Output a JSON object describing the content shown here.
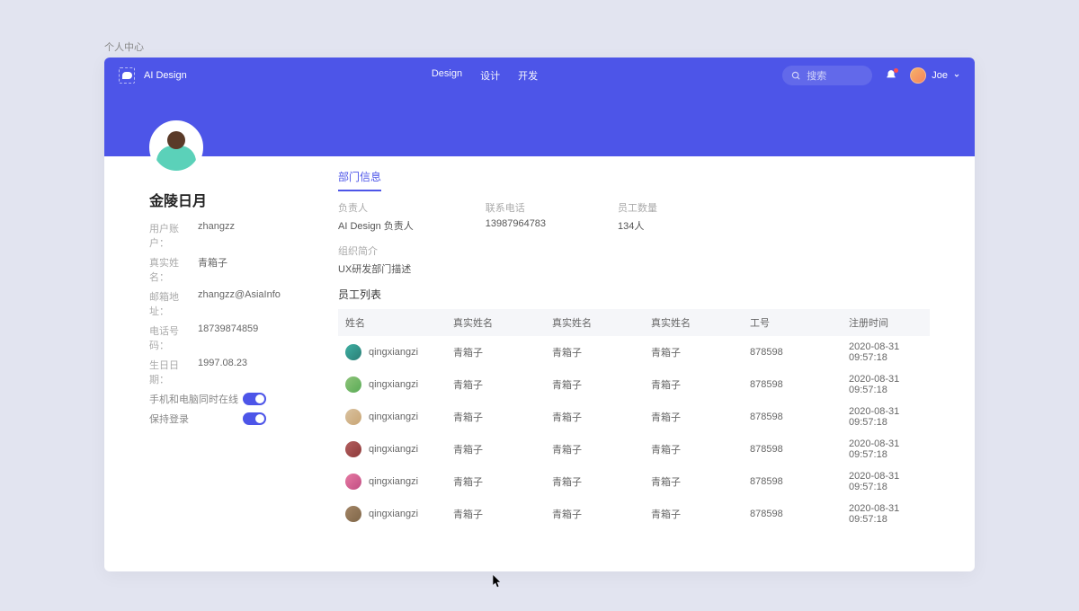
{
  "breadcrumb": "个人中心",
  "header": {
    "brand": "AI Design",
    "nav": {
      "design": "Design",
      "sheji": "设计",
      "kaifa": "开发"
    },
    "search_placeholder": "搜索",
    "user_name": "Joe"
  },
  "profile": {
    "name": "金陵日月",
    "meta": {
      "account_label": "用户账户：",
      "account_value": "zhangzz",
      "realname_label": "真实姓名：",
      "realname_value": "青箱子",
      "email_label": "邮箱地址：",
      "email_value": "zhangzz@AsiaInfo",
      "phone_label": "电话号码：",
      "phone_value": "18739874859",
      "birth_label": "生日日期：",
      "birth_value": "1997.08.23"
    },
    "toggle1_label": "手机和电脑同时在线",
    "toggle2_label": "保持登录"
  },
  "tabs": {
    "dept": "部门信息"
  },
  "dept_info": {
    "manager_label": "负责人",
    "manager_value": "AI Design 负责人",
    "phone_label": "联系电话",
    "phone_value": "13987964783",
    "count_label": "员工数量",
    "count_value": "134人",
    "desc_label": "组织简介",
    "desc_value": "UX研发部门描述"
  },
  "list_title": "员工列表",
  "columns": {
    "c0": "姓名",
    "c1": "真实姓名",
    "c2": "真实姓名",
    "c3": "真实姓名",
    "c4": "工号",
    "c5": "注册时间"
  },
  "rows": [
    {
      "name": "qingxiangzi",
      "real1": "青箱子",
      "real2": "青箱子",
      "real3": "青箱子",
      "code": "878598",
      "time": "2020-08-31 09:57:18"
    },
    {
      "name": "qingxiangzi",
      "real1": "青箱子",
      "real2": "青箱子",
      "real3": "青箱子",
      "code": "878598",
      "time": "2020-08-31 09:57:18"
    },
    {
      "name": "qingxiangzi",
      "real1": "青箱子",
      "real2": "青箱子",
      "real3": "青箱子",
      "code": "878598",
      "time": "2020-08-31 09:57:18"
    },
    {
      "name": "qingxiangzi",
      "real1": "青箱子",
      "real2": "青箱子",
      "real3": "青箱子",
      "code": "878598",
      "time": "2020-08-31 09:57:18"
    },
    {
      "name": "qingxiangzi",
      "real1": "青箱子",
      "real2": "青箱子",
      "real3": "青箱子",
      "code": "878598",
      "time": "2020-08-31 09:57:18"
    },
    {
      "name": "qingxiangzi",
      "real1": "青箱子",
      "real2": "青箱子",
      "real3": "青箱子",
      "code": "878598",
      "time": "2020-08-31 09:57:18"
    }
  ]
}
